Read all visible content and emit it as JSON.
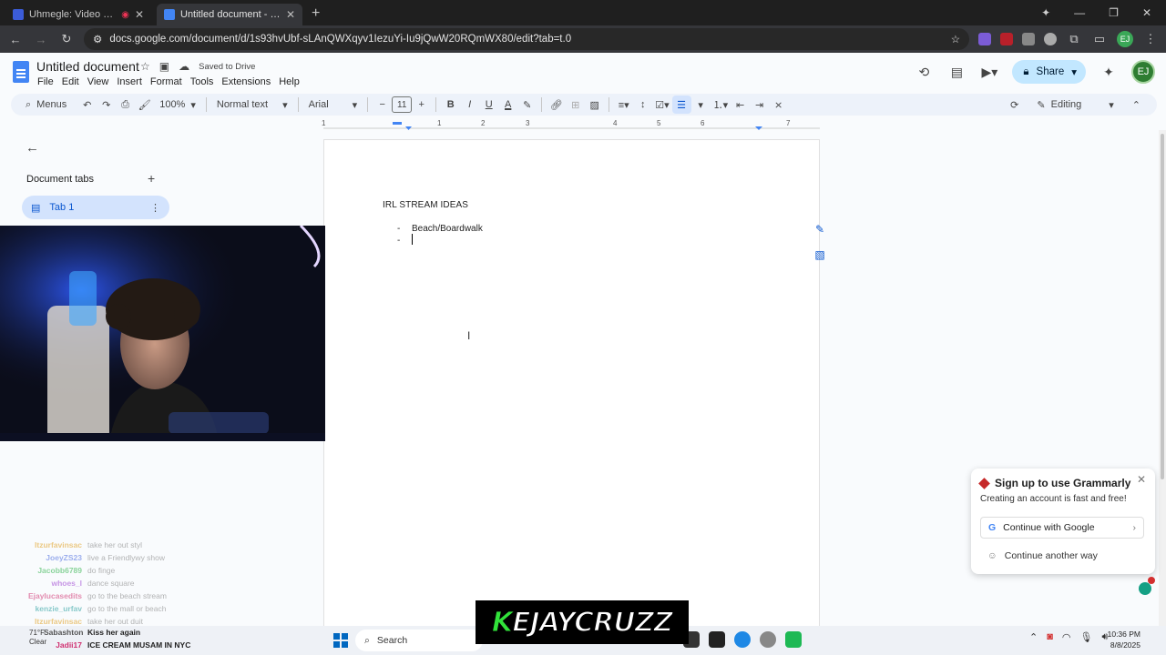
{
  "browser": {
    "tabs": [
      {
        "title": "Uhmegle: Video Chat | Omeg",
        "active": false,
        "favicon_color": "#3b5cd9"
      },
      {
        "title": "Untitled document - Google Docs",
        "active": true,
        "favicon_color": "#4285f4"
      }
    ],
    "url": "docs.google.com/document/d/1s93hvUbf-sLAnQWXqyv1IezuYi-Iu9jQwW20RQmWX80/edit?tab=t.0"
  },
  "docs": {
    "title": "Untitled document",
    "saved_status": "Saved to Drive",
    "menus": [
      "File",
      "Edit",
      "View",
      "Insert",
      "Format",
      "Tools",
      "Extensions",
      "Help"
    ],
    "share_label": "Share",
    "avatar_initials": "EJ",
    "accent": "#0b57d0"
  },
  "toolbar": {
    "menus_label": "Menus",
    "zoom": "100%",
    "style": "Normal text",
    "font": "Arial",
    "font_size": "11",
    "mode": "Editing"
  },
  "ruler": {
    "numbers": [
      "1",
      "1",
      "2",
      "3",
      "4",
      "5",
      "6",
      "7"
    ]
  },
  "sidebar": {
    "heading": "Document tabs",
    "tabs": [
      {
        "label": "Tab 1"
      }
    ]
  },
  "document": {
    "heading": "IRL STREAM IDEAS",
    "bullets": [
      {
        "dash": "-",
        "text": "Beach/Boardwalk"
      },
      {
        "dash": "-",
        "text": ""
      }
    ]
  },
  "grammarly": {
    "title": "Sign up to use Grammarly",
    "subtitle": "Creating an account is fast and free!",
    "google_button": "Continue with Google",
    "alt_button": "Continue another way"
  },
  "stream_chat": [
    {
      "user": "Itzurfavinsac",
      "msg": "take her out styl",
      "color": "#e0a020"
    },
    {
      "user": "JoeyZS23",
      "msg": "live a Friendlywy show",
      "color": "#4f6fe0"
    },
    {
      "user": "Jacobb6789",
      "msg": "do finge",
      "color": "#2fb34a"
    },
    {
      "user": "whoes_l",
      "msg": "dance square",
      "color": "#9b3fd0"
    },
    {
      "user": "Ejaylucasedits",
      "msg": "go to the beach stream",
      "color": "#d02f6f"
    },
    {
      "user": "kenzie_urfav",
      "msg": "go to the mall or beach",
      "color": "#2aa0a0"
    },
    {
      "user": "Itzurfavinsac",
      "msg": "take her out duit",
      "color": "#e0a020"
    }
  ],
  "bottom_chat": [
    {
      "user": "Sabashton",
      "msg": "Kiss her again"
    },
    {
      "user": "Jadii17",
      "msg": "ICE CREAM MUSAM IN NYC"
    }
  ],
  "weather": {
    "temp": "71°F",
    "condition": "Clear"
  },
  "taskbar": {
    "search_label": "Search"
  },
  "clock": {
    "time": "10:36 PM",
    "date": "8/8/2025"
  },
  "banner": {
    "text_k": "K",
    "text_rest": "EJAYCRUZZ"
  }
}
